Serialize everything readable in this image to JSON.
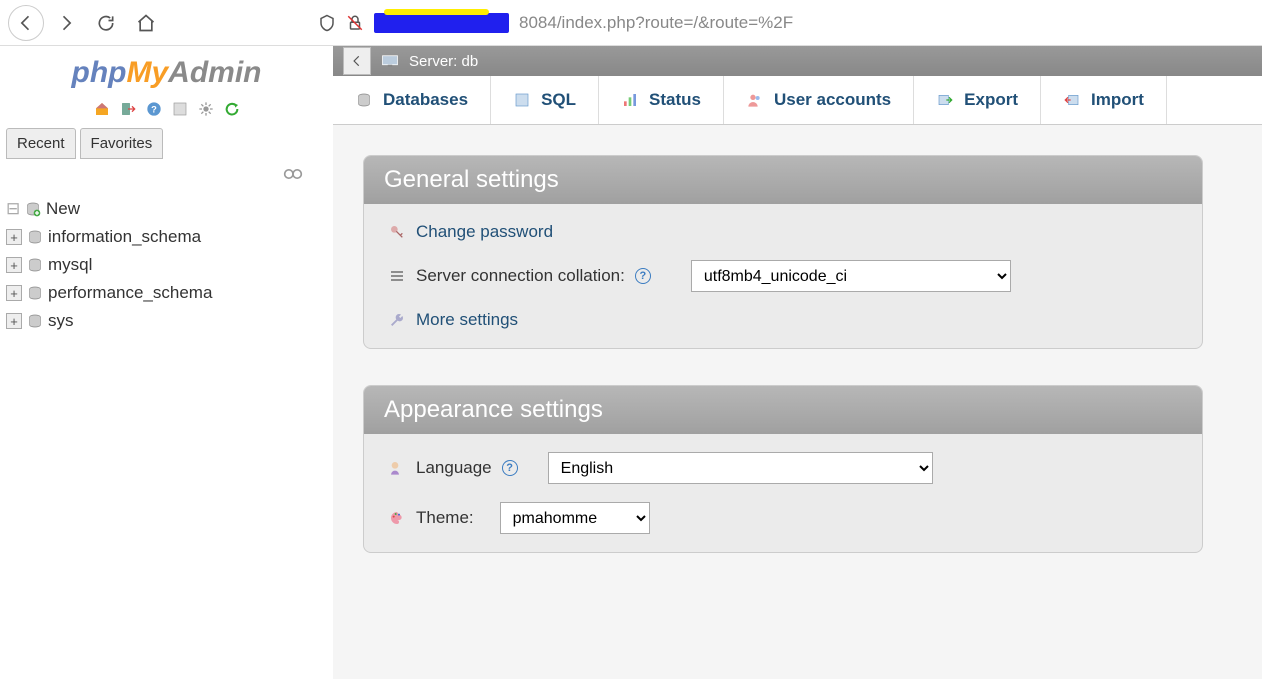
{
  "browser": {
    "url_suffix": "8084/index.php?route=/&route=%2F"
  },
  "logo": {
    "php": "php",
    "my": "My",
    "admin": "Admin"
  },
  "sidebar": {
    "tabs": {
      "recent": "Recent",
      "favorites": "Favorites"
    },
    "tree": {
      "new": "New",
      "items": [
        {
          "name": "information_schema"
        },
        {
          "name": "mysql"
        },
        {
          "name": "performance_schema"
        },
        {
          "name": "sys"
        }
      ]
    }
  },
  "server_bar": {
    "label": "Server: db"
  },
  "main_tabs": [
    {
      "label": "Databases",
      "icon": "db"
    },
    {
      "label": "SQL",
      "icon": "sql"
    },
    {
      "label": "Status",
      "icon": "status"
    },
    {
      "label": "User accounts",
      "icon": "users"
    },
    {
      "label": "Export",
      "icon": "export"
    },
    {
      "label": "Import",
      "icon": "import"
    }
  ],
  "panels": {
    "general": {
      "title": "General settings",
      "change_password": "Change password",
      "collation_label": "Server connection collation:",
      "collation_value": "utf8mb4_unicode_ci",
      "more_settings": "More settings"
    },
    "appearance": {
      "title": "Appearance settings",
      "language_label": "Language",
      "language_value": "English",
      "theme_label": "Theme:",
      "theme_value": "pmahomme"
    }
  }
}
